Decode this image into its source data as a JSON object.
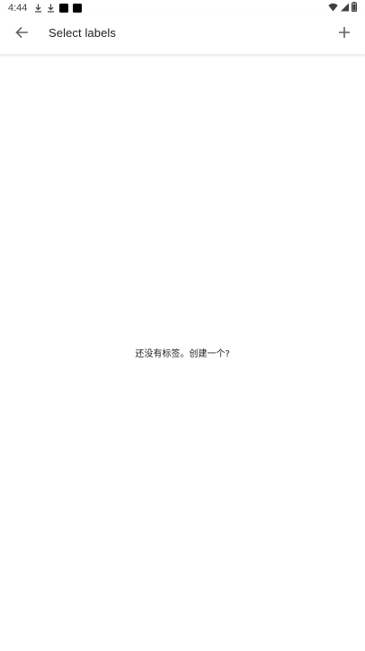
{
  "status_bar": {
    "time": "4:44",
    "icons": [
      "download-icon",
      "download-icon",
      "app-notification-icon",
      "app-notification-icon",
      "wifi-icon",
      "cell-signal-icon",
      "battery-icon"
    ]
  },
  "app_bar": {
    "title": "Select labels",
    "back_icon": "arrow-back-icon",
    "add_icon": "add-icon"
  },
  "main": {
    "empty_message": "还没有标签。创建一个?"
  },
  "colors": {
    "background": "#ffffff",
    "text": "#202124",
    "icon": "#5f6368"
  }
}
